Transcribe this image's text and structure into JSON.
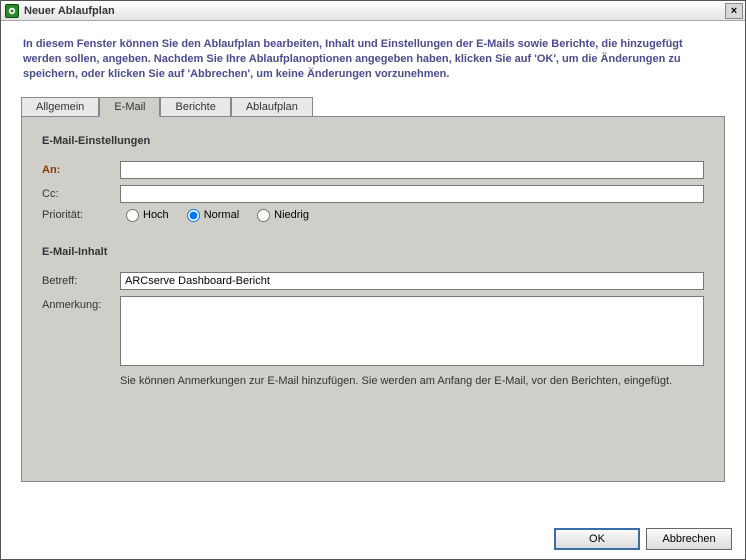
{
  "window": {
    "title": "Neuer Ablaufplan",
    "close_glyph": "×"
  },
  "header": {
    "description": "In diesem Fenster können Sie den Ablaufplan bearbeiten, Inhalt und Einstellungen der E-Mails sowie Berichte, die hinzugefügt werden sollen, angeben. Nachdem Sie Ihre Ablaufplanoptionen angegeben haben, klicken Sie auf 'OK', um die Änderungen zu speichern, oder klicken Sie auf 'Abbrechen', um keine Änderungen vorzunehmen."
  },
  "tabs": {
    "general": "Allgemein",
    "email": "E-Mail",
    "reports": "Berichte",
    "schedule": "Ablaufplan",
    "active": "email"
  },
  "email": {
    "settings_title": "E-Mail-Einstellungen",
    "to_label": "An:",
    "to_value": "",
    "cc_label": "Cc:",
    "cc_value": "",
    "priority_label": "Priorität:",
    "priority_high": "Hoch",
    "priority_normal": "Normal",
    "priority_low": "Niedrig",
    "priority_selected": "normal",
    "content_title": "E-Mail-Inhalt",
    "subject_label": "Betreff:",
    "subject_value": "ARCserve Dashboard-Bericht",
    "note_label": "Anmerkung:",
    "note_value": "",
    "hint": "Sie können Anmerkungen zur E-Mail hinzufügen. Sie werden am Anfang der E-Mail, vor den Berichten, eingefügt."
  },
  "footer": {
    "ok": "OK",
    "cancel": "Abbrechen"
  }
}
